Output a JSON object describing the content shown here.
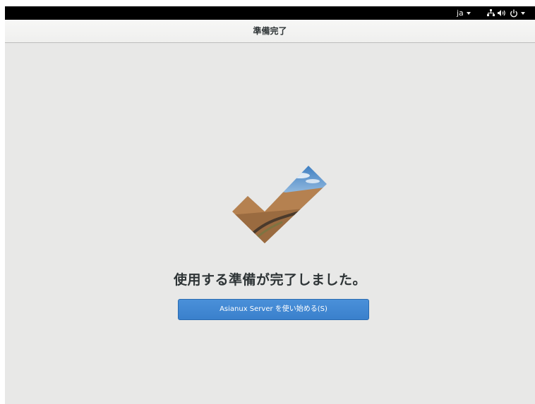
{
  "topbar": {
    "language": "ja",
    "icons": [
      "network-icon",
      "volume-icon",
      "power-icon"
    ]
  },
  "header": {
    "title": "準備完了"
  },
  "main": {
    "heading": "使用する準備が完了しました。",
    "button_label": "Asianux Server を使い始める(S)"
  },
  "colors": {
    "accent": "#3d85d1",
    "background": "#e8e8e7",
    "topbar": "#000000"
  }
}
